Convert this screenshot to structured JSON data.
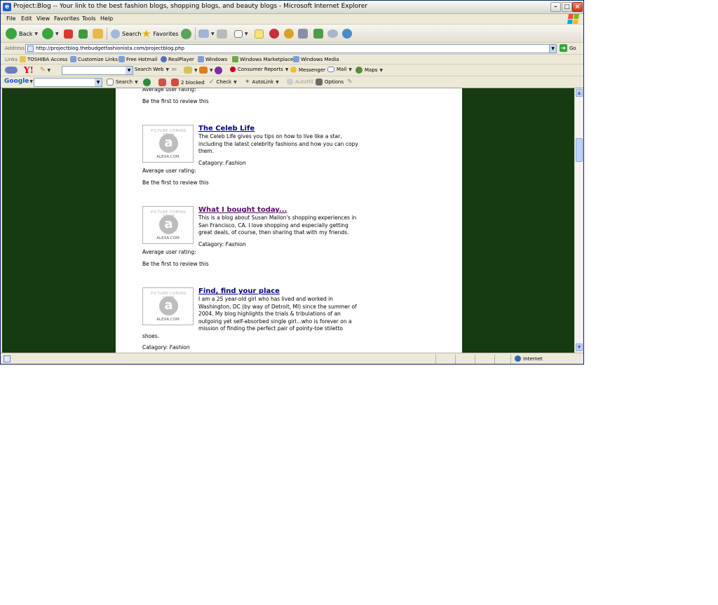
{
  "window": {
    "title": "Project:Blog -- Your link to the best fashion blogs, shopping blogs, and beauty blogs - Microsoft Internet Explorer",
    "app_icon": "e"
  },
  "menu": [
    "File",
    "Edit",
    "View",
    "Favorites",
    "Tools",
    "Help"
  ],
  "toolbar": {
    "back": "Back",
    "search": "Search",
    "favorites": "Favorites"
  },
  "address": {
    "label": "Address",
    "url": "http://projectblog.thebudgetfashionista.com/projectblog.php",
    "go": "Go"
  },
  "links": {
    "label": "Links",
    "items": [
      "TOSHIBA Access",
      "Customize Links",
      "Free Hotmail",
      "RealPlayer",
      "Windows",
      "Windows Marketplace",
      "Windows Media"
    ]
  },
  "yahoo": {
    "logo": "Y!",
    "search_web": "Search Web",
    "consumer_reports": "Consumer Reports",
    "messenger": "Messenger",
    "mail": "Mail",
    "maps": "Maps"
  },
  "google": {
    "logo": "Google",
    "search": "Search",
    "blocked": "2 blocked",
    "check": "Check",
    "autolink": "AutoLink",
    "autofill": "AutoFill",
    "options": "Options"
  },
  "content": {
    "avg_rating_label": "Average user rating:",
    "review_prompt": "Be the first to review this",
    "category_label": "Catagory:",
    "thumb_soon": "PICTURE COMING SOON",
    "thumb_letter": "a",
    "thumb_brand": "ALEXA.COM",
    "blogs": [
      {
        "title": "The Celeb Life",
        "description": "The Celeb Life gives you tips on how to live like a star, including the latest celebrity fashions and how you can copy them.",
        "category": "Fashion"
      },
      {
        "title": "What I bought today...",
        "description": "This is a blog about Susan Mallon's shopping experiences in San Francisco, CA. I love shopping and especially getting great deals, of course, then sharing that with my friends.",
        "category": "Fashion"
      },
      {
        "title": "Find, find your place",
        "description": "I am a 25 year-old girl who has lived and worked in Washington, DC (by way of Detroit, MI) since the summer of 2004. My blog highlights the trials & tribulations of an outgoing yet self-absorbed single girl...who is forever on a mission of finding the perfect pair of pointy-toe stiletto",
        "description_tail": "shoes.",
        "category": "Fashion"
      }
    ]
  },
  "status": {
    "zone": "Internet"
  },
  "colors": {
    "page_background": "#163a12",
    "link": "#00008b",
    "visited_link": "#5b0a6e"
  }
}
